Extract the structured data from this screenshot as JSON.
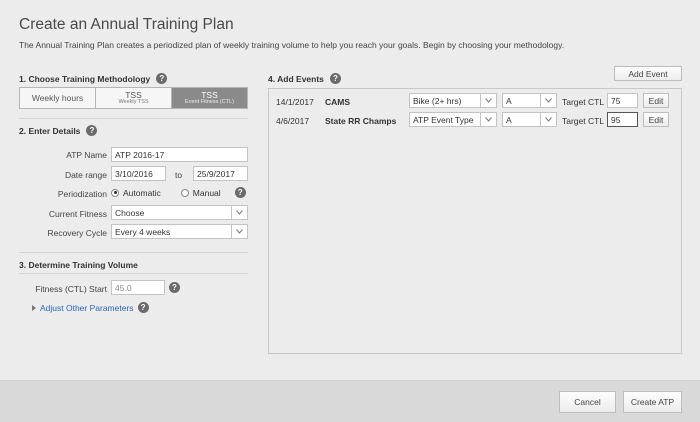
{
  "header": {
    "title": "Create an Annual Training Plan",
    "subtitle": "The Annual Training Plan creates a periodized plan of weekly training volume to help you reach your goals. Begin by choosing your methodology."
  },
  "section1": {
    "heading": "1. Choose Training Methodology",
    "options": [
      {
        "label": "Weekly hours",
        "sub": ""
      },
      {
        "label": "TSS",
        "sub": "Weekly TSS"
      },
      {
        "label": "TSS",
        "sub": "Event Fitness (CTL)"
      }
    ],
    "selected_index": 2
  },
  "section2": {
    "heading": "2. Enter Details",
    "atp_name_label": "ATP Name",
    "atp_name_value": "ATP 2016-17",
    "date_range_label": "Date range",
    "date_from": "3/10/2016",
    "date_to_label": "to",
    "date_to": "25/9/2017",
    "periodization_label": "Periodization",
    "periodization_auto": "Automatic",
    "periodization_manual": "Manual",
    "periodization_selected": "Automatic",
    "current_fitness_label": "Current Fitness",
    "current_fitness_value": "Choose",
    "recovery_cycle_label": "Recovery Cycle",
    "recovery_cycle_value": "Every 4 weeks"
  },
  "section3": {
    "heading": "3. Determine Training Volume",
    "fitness_start_label": "Fitness (CTL) Start",
    "fitness_start_value": "45.0",
    "adjust_link": "Adjust Other Parameters"
  },
  "section4": {
    "heading": "4. Add Events",
    "add_event_label": "Add Event",
    "target_label": "Target CTL",
    "edit_label": "Edit",
    "events": [
      {
        "date": "14/1/2017",
        "name": "CAMS",
        "type": "Bike (2+ hrs)",
        "priority": "A",
        "target": "75"
      },
      {
        "date": "4/6/2017",
        "name": "State RR Champs",
        "type": "ATP Event Type",
        "priority": "A",
        "target": "95"
      }
    ]
  },
  "footer": {
    "cancel_label": "Cancel",
    "create_label": "Create ATP"
  }
}
